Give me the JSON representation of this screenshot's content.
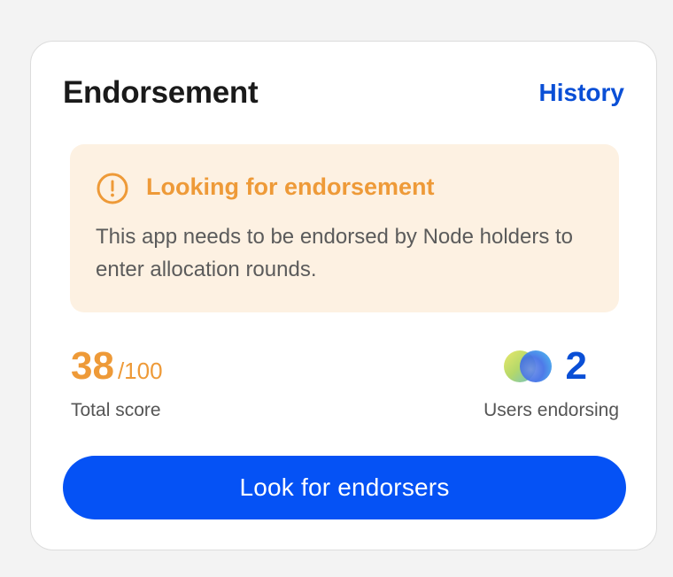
{
  "card": {
    "title": "Endorsement",
    "history_link": "History"
  },
  "alert": {
    "icon": "exclamation-circle-icon",
    "title": "Looking for endorsement",
    "message": "This app needs to be endorsed by Node holders to enter allocation rounds."
  },
  "score": {
    "value": "38",
    "max": "/100",
    "label": "Total score"
  },
  "endorsers": {
    "count": "2",
    "label": "Users endorsing",
    "avatar_icons": [
      "user-avatar-icon",
      "user-avatar-icon"
    ]
  },
  "cta": {
    "label": "Look for endorsers"
  },
  "colors": {
    "accent_blue": "#0552f5",
    "link_blue": "#0a4fd6",
    "warning_orange": "#ee9a38",
    "alert_background": "#fdf1e2"
  }
}
